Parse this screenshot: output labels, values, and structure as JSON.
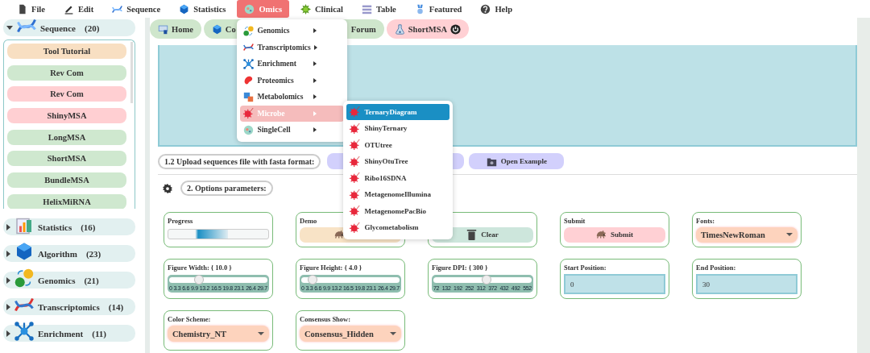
{
  "menubar": [
    {
      "label": "File",
      "selected": false
    },
    {
      "label": "Edit",
      "selected": false
    },
    {
      "label": "Sequence",
      "selected": false
    },
    {
      "label": "Statistics",
      "selected": false
    },
    {
      "label": "Omics",
      "selected": true,
      "menu": [
        {
          "label": "Genomics",
          "selected": false
        },
        {
          "label": "Transcriptomics",
          "selected": false
        },
        {
          "label": "Enrichment",
          "selected": false
        },
        {
          "label": "Proteomics",
          "selected": false
        },
        {
          "label": "Metabolomics",
          "selected": false
        },
        {
          "label": "Microbe",
          "selected": true,
          "submenu": [
            {
              "label": "TernaryDiagram",
              "selected": true
            },
            {
              "label": "ShinyTernary",
              "selected": false
            },
            {
              "label": "OTUtree",
              "selected": false
            },
            {
              "label": "ShinyOtuTree",
              "selected": false
            },
            {
              "label": "Ribo16SDNA",
              "selected": false
            },
            {
              "label": "MetagenomeIllumina",
              "selected": false
            },
            {
              "label": "MetagenomePacBio",
              "selected": false
            },
            {
              "label": "Glycometabolism",
              "selected": false
            }
          ]
        },
        {
          "label": "SingleCell",
          "selected": false
        }
      ]
    },
    {
      "label": "Clinical",
      "selected": false
    },
    {
      "label": "Table",
      "selected": false
    },
    {
      "label": "Featured",
      "selected": false
    },
    {
      "label": "Help",
      "selected": false
    }
  ],
  "sidebar": {
    "groups": [
      {
        "label": "Sequence",
        "count": "(20)",
        "expanded": true,
        "items": [
          {
            "label": "Tool Tutorial",
            "color": "#f8dfc2"
          },
          {
            "label": "Rev Com",
            "color": "#cfe8cf"
          },
          {
            "label": "Rev Com",
            "color": "#ffcfd2"
          },
          {
            "label": "ShinyMSA",
            "color": "#ffcfd2"
          },
          {
            "label": "LongMSA",
            "color": "#cfe8cf"
          },
          {
            "label": "ShortMSA",
            "color": "#cfe8cf"
          },
          {
            "label": "BundleMSA",
            "color": "#cfe8cf"
          },
          {
            "label": "HelixMiRNA",
            "color": "#cfe8cf"
          }
        ]
      },
      {
        "label": "Statistics",
        "count": "(16)",
        "expanded": false
      },
      {
        "label": "Algorithm",
        "count": "(23)",
        "expanded": false
      },
      {
        "label": "Genomics",
        "count": "(21)",
        "expanded": false
      },
      {
        "label": "Transcriptomics",
        "count": "(14)",
        "expanded": false
      },
      {
        "label": "Enrichment",
        "count": "(11)",
        "expanded": false
      }
    ]
  },
  "tabs": [
    {
      "label": "Home",
      "color": "#cfe6cc",
      "closable": false
    },
    {
      "label": "Co",
      "color": "#cfe6cc",
      "closable": false
    },
    {
      "label": "Forum",
      "color": "#cfe6cc",
      "closable": false
    },
    {
      "label": "ShortMSA",
      "color": "#ffd0d4",
      "closable": true
    }
  ],
  "upload": {
    "label": "1.2 Upload sequences file with fasta format:",
    "example_button": "Open Example"
  },
  "options": {
    "title": "2. Options parameters:",
    "cards": [
      {
        "kind": "progress",
        "label": "Progress",
        "level": 0.6
      },
      {
        "kind": "button",
        "label": "Demo",
        "color": "#f8e3c6"
      },
      {
        "kind": "button",
        "button": "Clear",
        "color": "#cde6dc"
      },
      {
        "kind": "button",
        "label": "Submit",
        "button": "Submit",
        "color": "#ffd0d4"
      },
      {
        "kind": "select",
        "label": "Fonts:",
        "value": "TimesNewRoman"
      },
      {
        "kind": "slider",
        "label": "Figure Width: { 10.0 }",
        "level": 0.31,
        "ticks": [
          "0",
          "3.3",
          "6.6",
          "9.9",
          "13.2",
          "16.5",
          "19.8",
          "23.1",
          "26.4",
          "29.7"
        ]
      },
      {
        "kind": "slider",
        "label": "Figure Height: { 4.0 }",
        "level": 0.12,
        "ticks": [
          "0",
          "3.3",
          "6.6",
          "9.9",
          "13.2",
          "16.5",
          "19.8",
          "23.1",
          "26.4",
          "29.7"
        ]
      },
      {
        "kind": "slider",
        "label": "Figure DPI: { 300 }",
        "level": 0.55,
        "ticks": [
          "72",
          "132",
          "192",
          "252",
          "312",
          "372",
          "432",
          "492",
          "552"
        ]
      },
      {
        "kind": "input",
        "label": "Start Position:",
        "value": "0"
      },
      {
        "kind": "input",
        "label": "End Position:",
        "value": "30"
      },
      {
        "kind": "select",
        "label": "Color Scheme:",
        "value": "Chemistry_NT"
      },
      {
        "kind": "select",
        "label": "Consensus Show:",
        "value": "Consensus_Hidden"
      }
    ]
  }
}
